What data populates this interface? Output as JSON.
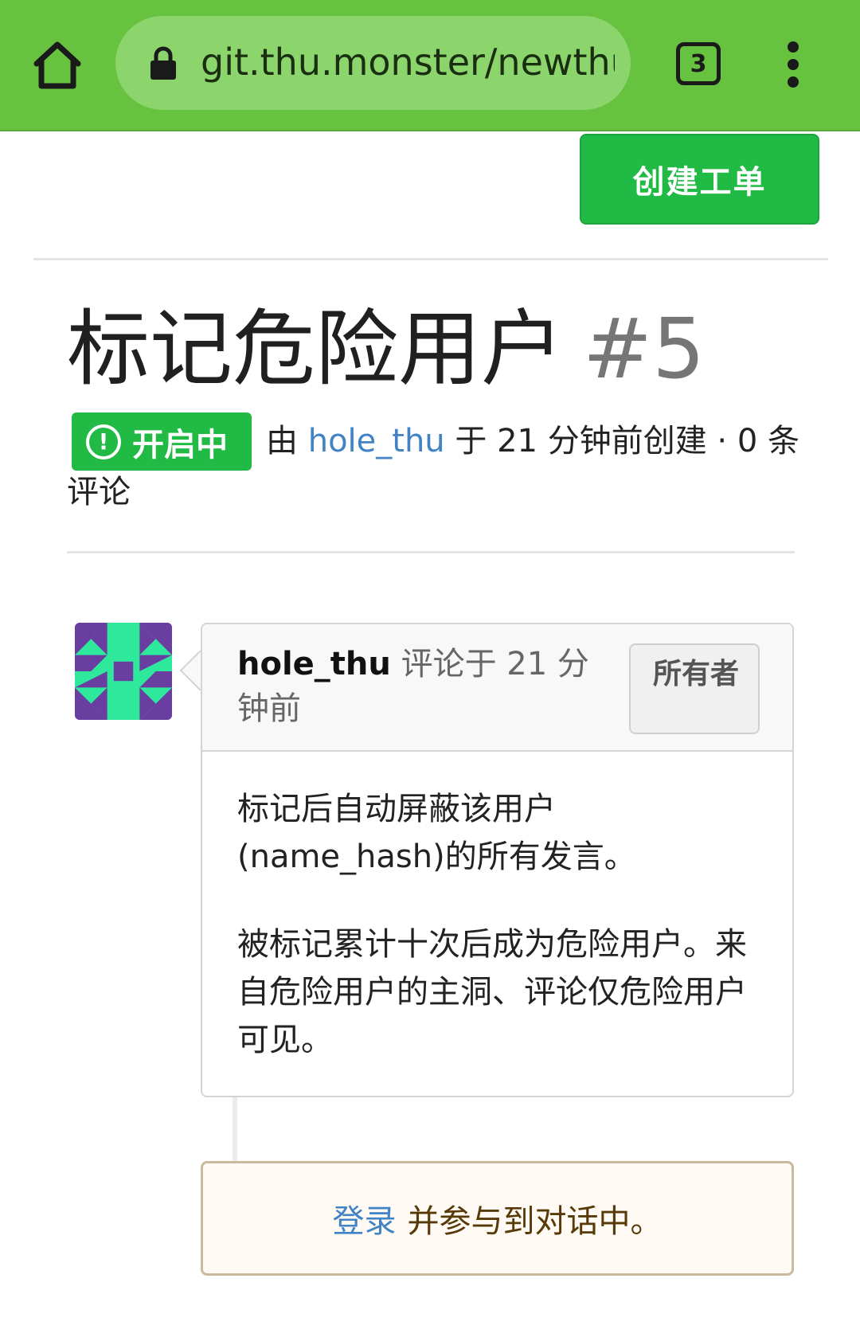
{
  "browser": {
    "url": "git.thu.monster/newthuhole",
    "tab_count": "3"
  },
  "toolbar": {
    "create_issue_label": "创建工单"
  },
  "issue": {
    "title": "标记危险用户",
    "number": "#5",
    "status_label": "开启中",
    "status_icon": "alert-circle-icon",
    "meta_prefix": "由",
    "author": "hole_thu",
    "meta_suffix": "于 21 分钟前创建 · 0 条",
    "meta_suffix_line2": "评论"
  },
  "comment": {
    "author": "hole_thu",
    "time_text": "评论于 21 分钟前",
    "role_badge": "所有者",
    "paragraph_1": "标记后自动屏蔽该用户(name_hash)的所有发言。",
    "paragraph_2": "被标记累计十次后成为危险用户。来自危险用户的主洞、评论仅危险用户可见。"
  },
  "login_prompt": {
    "link_label": "登录",
    "text": "并参与到对话中。"
  },
  "colors": {
    "browser_bar": "#66c23f",
    "url_pill": "#8bd56c",
    "primary_green": "#21ba45",
    "link_blue": "#4183c4",
    "avatar_bg": "#2ee89b",
    "avatar_fg": "#6a3ea1"
  }
}
